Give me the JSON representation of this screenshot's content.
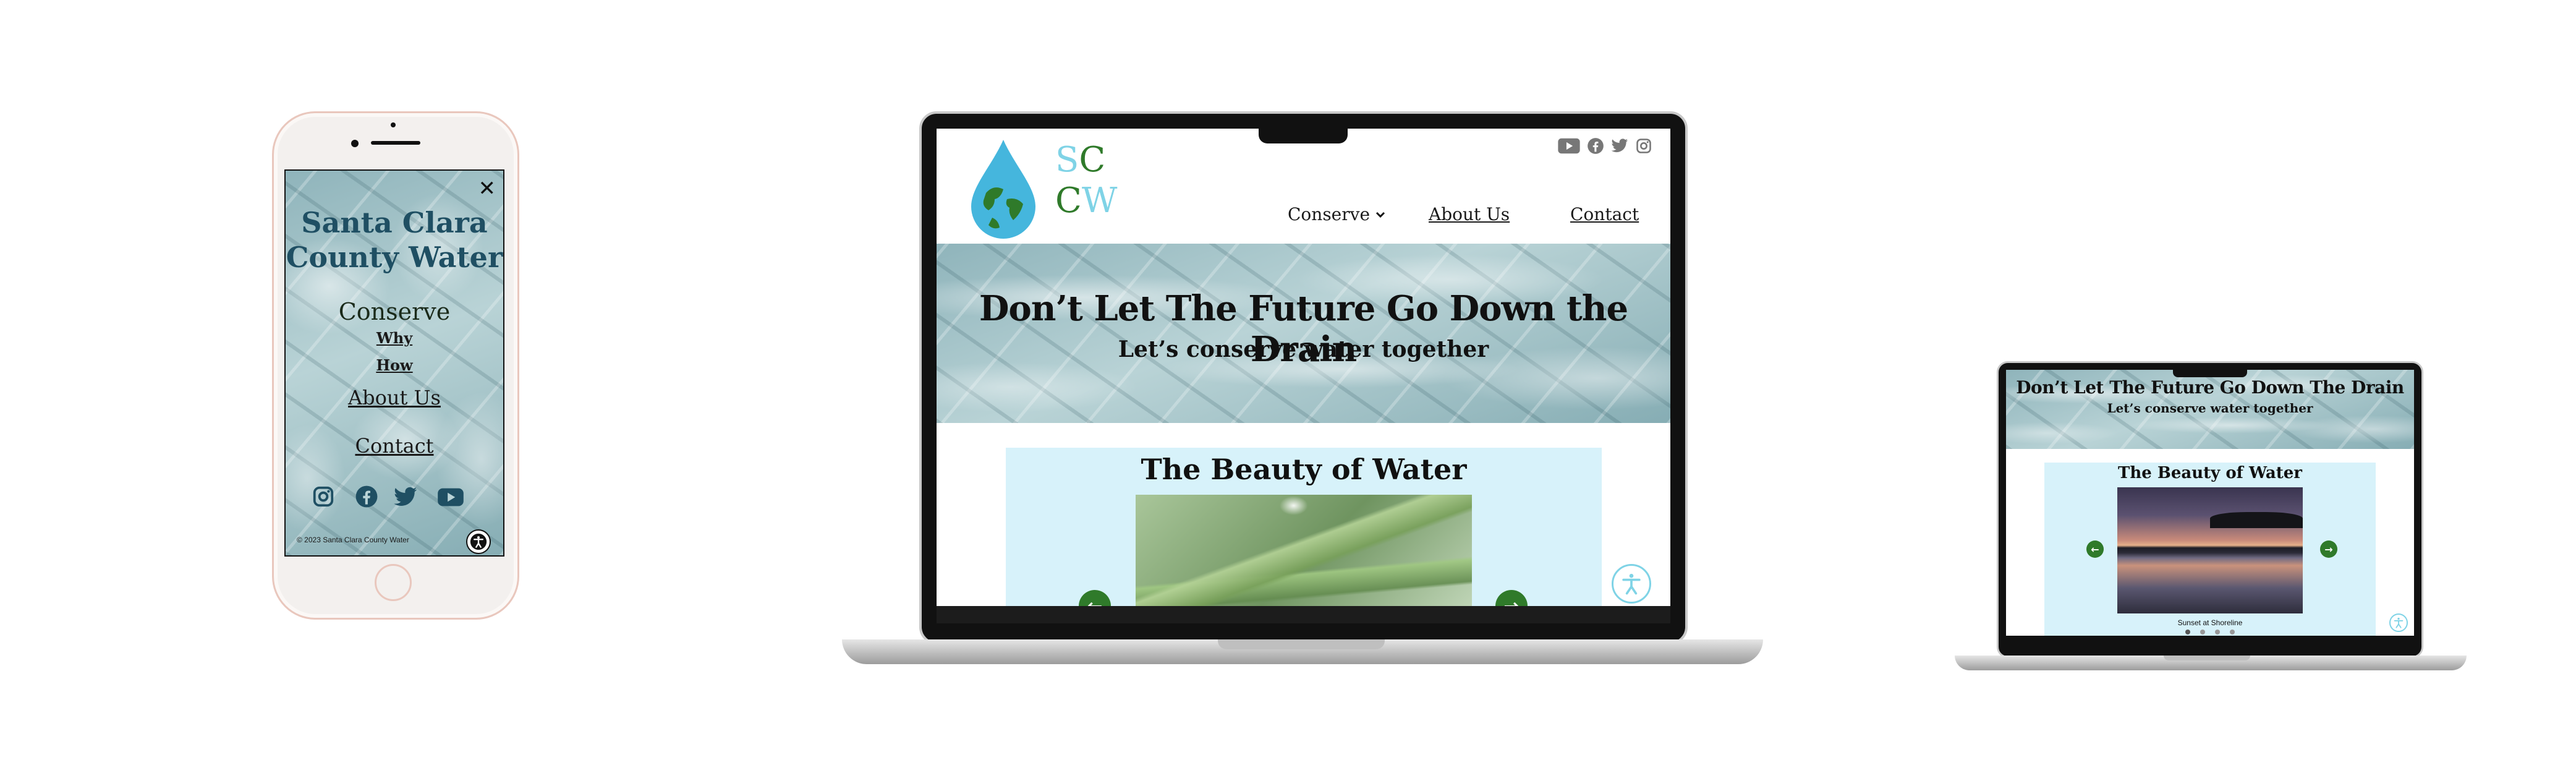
{
  "colors": {
    "brand_dark": "#1f4f63",
    "brand_green": "#2f7a2a",
    "brand_aqua": "#7fd3e6",
    "panel_bg": "#d7f2fa",
    "icon_grey": "#777777"
  },
  "phone": {
    "title_line1": "Santa Clara",
    "title_line2": "County Water",
    "menu": {
      "conserve": "Conserve",
      "why": "Why",
      "how": "How",
      "about": "About Us",
      "contact": "Contact"
    },
    "social_icons": [
      "instagram-icon",
      "facebook-icon",
      "twitter-icon",
      "youtube-icon"
    ],
    "footer": "© 2023 Santa Clara County Water",
    "close_glyph": "✕"
  },
  "desktop": {
    "logo": {
      "s": "S",
      "c1": "C",
      "c2": "C",
      "w": "W"
    },
    "social_icons": [
      "youtube-icon",
      "facebook-icon",
      "twitter-icon",
      "instagram-icon"
    ],
    "nav": {
      "conserve": "Conserve",
      "about": "About Us",
      "contact": "Contact"
    },
    "hero": {
      "title": "Don’t Let The Future Go Down the Drain",
      "subtitle": "Let’s conserve water together"
    },
    "section_title": "The Beauty of Water"
  },
  "small_laptop": {
    "hero": {
      "title": "Don’t Let The Future Go Down The Drain",
      "subtitle": "Let’s conserve water together"
    },
    "section_title": "The Beauty of Water",
    "caption": "Sunset at Shoreline",
    "carousel_dots": 4
  }
}
